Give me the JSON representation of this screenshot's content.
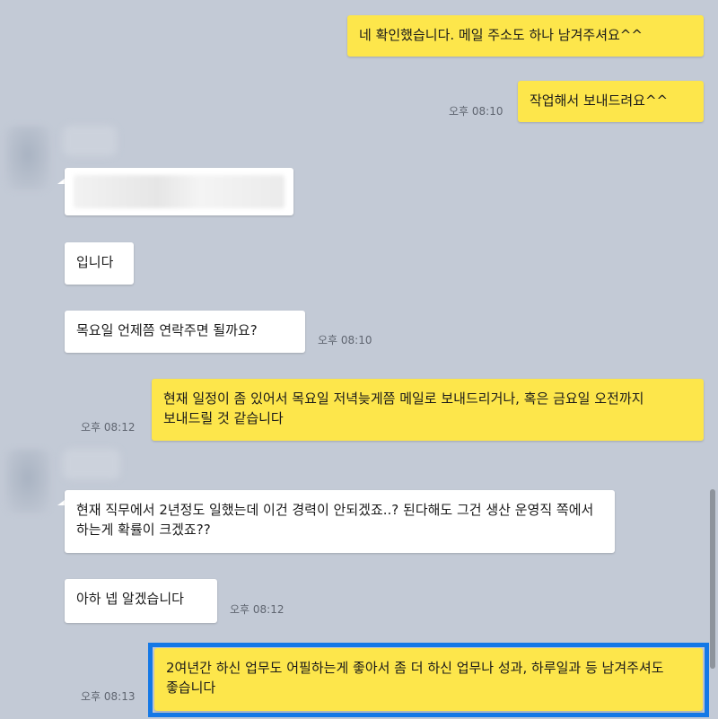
{
  "messages": [
    {
      "side": "mine",
      "text": "네 확인했습니다. 메일 주소도 하나 남겨주셔요^^",
      "time": ""
    },
    {
      "side": "mine",
      "text": "작업해서 보내드려요^^",
      "time": "오후 08:10"
    },
    {
      "side": "theirs",
      "text": "",
      "time": "",
      "redacted": true
    },
    {
      "side": "theirs",
      "text": "입니다",
      "time": ""
    },
    {
      "side": "theirs",
      "text": "목요일 언제쯤 연락주면 될까요?",
      "time": "오후 08:10"
    },
    {
      "side": "mine",
      "text": "현재 일정이 좀 있어서 목요일 저녁늦게쯤 메일로 보내드리거나, 혹은 금요일 오전까지 보내드릴 것 같습니다",
      "time": "오후 08:12"
    },
    {
      "side": "theirs",
      "text": "현재 직무에서 2년정도 일했는데 이건 경력이 안되겠죠..? 된다해도 그건 생산 운영직 쪽에서 하는게 확률이 크겠죠??",
      "time": ""
    },
    {
      "side": "theirs",
      "text": "아하 넵 알겠습니다",
      "time": "오후 08:12"
    },
    {
      "side": "mine",
      "text": "2여년간 하신 업무도 어필하는게 좋아서 좀 더 하신 업무나 성과, 하루일과 등 남겨주셔도 좋습니다",
      "time": "오후 08:13",
      "highlighted": true
    }
  ],
  "colors": {
    "background": "#c3cad6",
    "mine_bubble": "#fde64b",
    "theirs_bubble": "#ffffff",
    "highlight": "#1478e6"
  },
  "icons": [
    "avatar"
  ]
}
